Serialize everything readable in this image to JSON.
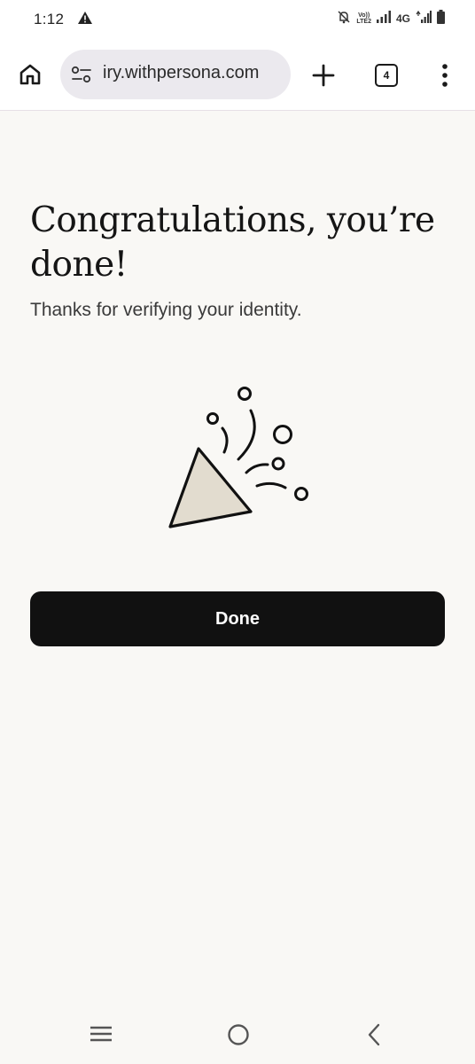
{
  "status_bar": {
    "time": "1:12",
    "volte_top": "Vo))",
    "volte_bottom": "LTE2",
    "network": "4G"
  },
  "browser": {
    "url": "iry.withpersona.com",
    "tab_count": "4"
  },
  "page": {
    "title": "Congratulations, you’re done!",
    "subtitle": "Thanks for verifying your identity.",
    "done_button": "Done"
  },
  "colors": {
    "background": "#f9f8f5",
    "button": "#111111",
    "party_hat_fill": "#e2dccf"
  }
}
